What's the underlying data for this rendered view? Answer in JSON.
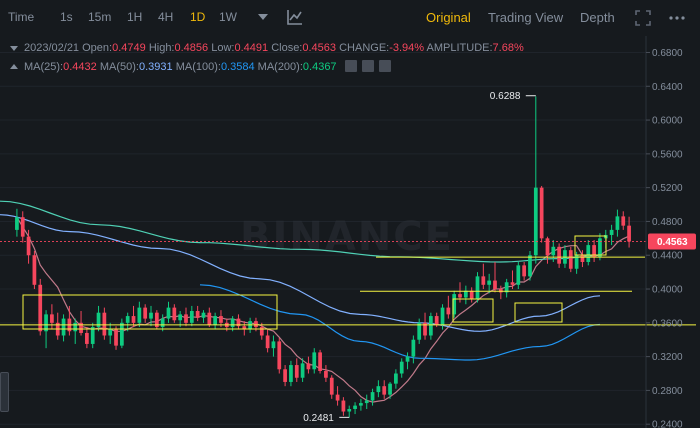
{
  "toolbar": {
    "time_label": "Time",
    "intervals": [
      "1s",
      "15m",
      "1H",
      "4H",
      "1D",
      "1W"
    ],
    "active_interval": "1D",
    "views": [
      "Original",
      "Trading View",
      "Depth"
    ],
    "active_view": "Original"
  },
  "ohlc": {
    "date": "2023/02/21",
    "open_label": "Open:",
    "open": "0.4749",
    "high_label": "High:",
    "high": "0.4856",
    "low_label": "Low:",
    "low": "0.4491",
    "close_label": "Close:",
    "close": "0.4563",
    "change_label": "CHANGE:",
    "change": "-3.94%",
    "amplitude_label": "AMPLITUDE:",
    "amplitude": "7.68%"
  },
  "ma": {
    "ma25_label": "MA(25):",
    "ma25": "0.4432",
    "ma50_label": "MA(50):",
    "ma50": "0.3931",
    "ma100_label": "MA(100):",
    "ma100": "0.3584",
    "ma200_label": "MA(200):",
    "ma200": "0.4367"
  },
  "colors": {
    "up": "#0ecb81",
    "down": "#f6465d",
    "ma25": "#c07a8a",
    "ma50": "#82b1ff",
    "ma100": "#2196f3",
    "ma200": "#4fd1b5",
    "annotation": "#f5f542",
    "accent": "#f0b90b"
  },
  "watermark": "BINANCE",
  "chart_data": {
    "type": "candlestick",
    "y_axis": {
      "ticks": [
        "0.6800",
        "0.6400",
        "0.6000",
        "0.5600",
        "0.5200",
        "0.4800",
        "0.4400",
        "0.4000",
        "0.3600",
        "0.3200",
        "0.2800",
        "0.2400"
      ],
      "tick_values": [
        0.68,
        0.64,
        0.6,
        0.56,
        0.52,
        0.48,
        0.44,
        0.4,
        0.36,
        0.32,
        0.28,
        0.24
      ],
      "range": [
        0.2355,
        0.6995
      ]
    },
    "current_price": "0.4563",
    "highest_label": "0.6288",
    "lowest_label": "0.2481",
    "annotation_levels": [
      0.4377,
      0.3973,
      0.3576
    ],
    "candles": [
      [
        0.47,
        0.495,
        0.462,
        0.485
      ],
      [
        0.485,
        0.492,
        0.455,
        0.462
      ],
      [
        0.462,
        0.47,
        0.43,
        0.44
      ],
      [
        0.44,
        0.445,
        0.4,
        0.405
      ],
      [
        0.405,
        0.412,
        0.345,
        0.35
      ],
      [
        0.35,
        0.375,
        0.33,
        0.37
      ],
      [
        0.37,
        0.382,
        0.352,
        0.36
      ],
      [
        0.36,
        0.372,
        0.34,
        0.345
      ],
      [
        0.345,
        0.37,
        0.338,
        0.365
      ],
      [
        0.365,
        0.38,
        0.345,
        0.35
      ],
      [
        0.35,
        0.365,
        0.335,
        0.36
      ],
      [
        0.36,
        0.374,
        0.345,
        0.348
      ],
      [
        0.348,
        0.355,
        0.33,
        0.335
      ],
      [
        0.335,
        0.36,
        0.33,
        0.355
      ],
      [
        0.355,
        0.38,
        0.35,
        0.372
      ],
      [
        0.372,
        0.378,
        0.34,
        0.345
      ],
      [
        0.345,
        0.36,
        0.335,
        0.352
      ],
      [
        0.352,
        0.356,
        0.328,
        0.333
      ],
      [
        0.333,
        0.365,
        0.33,
        0.36
      ],
      [
        0.36,
        0.372,
        0.35,
        0.368
      ],
      [
        0.368,
        0.38,
        0.355,
        0.36
      ],
      [
        0.36,
        0.385,
        0.355,
        0.378
      ],
      [
        0.378,
        0.382,
        0.36,
        0.365
      ],
      [
        0.365,
        0.38,
        0.356,
        0.372
      ],
      [
        0.372,
        0.375,
        0.352,
        0.355
      ],
      [
        0.355,
        0.37,
        0.35,
        0.365
      ],
      [
        0.365,
        0.385,
        0.36,
        0.378
      ],
      [
        0.378,
        0.382,
        0.36,
        0.363
      ],
      [
        0.363,
        0.374,
        0.355,
        0.37
      ],
      [
        0.37,
        0.378,
        0.356,
        0.36
      ],
      [
        0.36,
        0.38,
        0.356,
        0.374
      ],
      [
        0.374,
        0.38,
        0.362,
        0.366
      ],
      [
        0.366,
        0.375,
        0.36,
        0.372
      ],
      [
        0.372,
        0.378,
        0.355,
        0.358
      ],
      [
        0.358,
        0.372,
        0.352,
        0.368
      ],
      [
        0.368,
        0.375,
        0.355,
        0.36
      ],
      [
        0.36,
        0.365,
        0.35,
        0.355
      ],
      [
        0.355,
        0.368,
        0.35,
        0.365
      ],
      [
        0.365,
        0.37,
        0.352,
        0.356
      ],
      [
        0.356,
        0.362,
        0.345,
        0.352
      ],
      [
        0.352,
        0.366,
        0.348,
        0.362
      ],
      [
        0.362,
        0.366,
        0.35,
        0.355
      ],
      [
        0.355,
        0.36,
        0.34,
        0.345
      ],
      [
        0.345,
        0.352,
        0.325,
        0.33
      ],
      [
        0.33,
        0.345,
        0.32,
        0.338
      ],
      [
        0.338,
        0.342,
        0.3,
        0.305
      ],
      [
        0.305,
        0.31,
        0.285,
        0.29
      ],
      [
        0.29,
        0.315,
        0.285,
        0.31
      ],
      [
        0.31,
        0.318,
        0.29,
        0.295
      ],
      [
        0.295,
        0.318,
        0.29,
        0.312
      ],
      [
        0.312,
        0.32,
        0.3,
        0.305
      ],
      [
        0.305,
        0.33,
        0.3,
        0.325
      ],
      [
        0.325,
        0.328,
        0.3,
        0.303
      ],
      [
        0.303,
        0.31,
        0.29,
        0.295
      ],
      [
        0.295,
        0.298,
        0.27,
        0.275
      ],
      [
        0.275,
        0.285,
        0.262,
        0.268
      ],
      [
        0.268,
        0.272,
        0.25,
        0.255
      ],
      [
        0.255,
        0.262,
        0.248,
        0.258
      ],
      [
        0.258,
        0.266,
        0.252,
        0.262
      ],
      [
        0.262,
        0.27,
        0.256,
        0.265
      ],
      [
        0.265,
        0.275,
        0.258,
        0.268
      ],
      [
        0.268,
        0.282,
        0.262,
        0.278
      ],
      [
        0.278,
        0.292,
        0.272,
        0.285
      ],
      [
        0.285,
        0.292,
        0.27,
        0.275
      ],
      [
        0.275,
        0.29,
        0.27,
        0.288
      ],
      [
        0.288,
        0.305,
        0.282,
        0.3
      ],
      [
        0.3,
        0.318,
        0.295,
        0.314
      ],
      [
        0.314,
        0.325,
        0.305,
        0.32
      ],
      [
        0.32,
        0.345,
        0.312,
        0.34
      ],
      [
        0.34,
        0.365,
        0.335,
        0.36
      ],
      [
        0.36,
        0.372,
        0.34,
        0.345
      ],
      [
        0.345,
        0.372,
        0.34,
        0.368
      ],
      [
        0.368,
        0.372,
        0.355,
        0.358
      ],
      [
        0.358,
        0.382,
        0.352,
        0.378
      ],
      [
        0.378,
        0.392,
        0.365,
        0.37
      ],
      [
        0.37,
        0.398,
        0.366,
        0.394
      ],
      [
        0.394,
        0.408,
        0.384,
        0.39
      ],
      [
        0.39,
        0.404,
        0.382,
        0.398
      ],
      [
        0.398,
        0.402,
        0.384,
        0.388
      ],
      [
        0.388,
        0.42,
        0.384,
        0.415
      ],
      [
        0.415,
        0.43,
        0.4,
        0.405
      ],
      [
        0.405,
        0.418,
        0.395,
        0.41
      ],
      [
        0.41,
        0.432,
        0.396,
        0.4
      ],
      [
        0.4,
        0.404,
        0.388,
        0.396
      ],
      [
        0.396,
        0.412,
        0.39,
        0.408
      ],
      [
        0.408,
        0.422,
        0.4,
        0.405
      ],
      [
        0.405,
        0.432,
        0.4,
        0.428
      ],
      [
        0.428,
        0.432,
        0.41,
        0.415
      ],
      [
        0.415,
        0.445,
        0.41,
        0.44
      ],
      [
        0.44,
        0.628,
        0.43,
        0.52
      ],
      [
        0.52,
        0.522,
        0.455,
        0.46
      ],
      [
        0.46,
        0.462,
        0.43,
        0.44
      ],
      [
        0.44,
        0.458,
        0.432,
        0.45
      ],
      [
        0.45,
        0.454,
        0.425,
        0.43
      ],
      [
        0.43,
        0.452,
        0.425,
        0.446
      ],
      [
        0.446,
        0.45,
        0.42,
        0.424
      ],
      [
        0.424,
        0.444,
        0.418,
        0.44
      ],
      [
        0.44,
        0.446,
        0.426,
        0.432
      ],
      [
        0.432,
        0.458,
        0.428,
        0.452
      ],
      [
        0.452,
        0.458,
        0.432,
        0.438
      ],
      [
        0.438,
        0.466,
        0.434,
        0.46
      ],
      [
        0.46,
        0.47,
        0.448,
        0.464
      ],
      [
        0.464,
        0.476,
        0.452,
        0.47
      ],
      [
        0.47,
        0.494,
        0.462,
        0.486
      ],
      [
        0.486,
        0.492,
        0.47,
        0.475
      ],
      [
        0.475,
        0.4856,
        0.4491,
        0.4563
      ]
    ]
  }
}
